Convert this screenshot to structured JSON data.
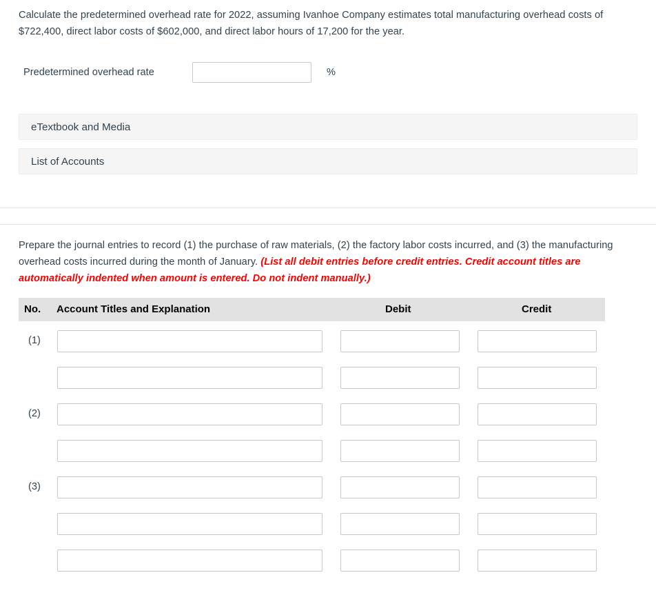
{
  "part_a": {
    "prompt": "Calculate the predetermined overhead rate for 2022, assuming Ivanhoe Company estimates total manufacturing overhead costs of $722,400, direct labor costs of $602,000, and direct labor hours of 17,200 for the year.",
    "rate_label": "Predetermined overhead rate",
    "rate_value": "",
    "rate_placeholder": "",
    "percent_symbol": "%",
    "accordions": [
      {
        "label": "eTextbook and Media"
      },
      {
        "label": "List of Accounts"
      }
    ]
  },
  "part_b": {
    "prompt_plain": "Prepare the journal entries to record (1) the purchase of raw materials, (2) the factory labor costs incurred, and (3) the manufacturing overhead costs incurred during the month of January. ",
    "prompt_note": "(List all debit entries before credit entries. Credit account titles are automatically indented when amount is entered. Do not indent manually.)",
    "table": {
      "columns": {
        "no": "No.",
        "account": "Account Titles and Explanation",
        "debit": "Debit",
        "credit": "Credit"
      },
      "rows": [
        {
          "no": "(1)",
          "account": "",
          "debit": "",
          "credit": ""
        },
        {
          "no": "",
          "account": "",
          "debit": "",
          "credit": ""
        },
        {
          "no": "(2)",
          "account": "",
          "debit": "",
          "credit": ""
        },
        {
          "no": "",
          "account": "",
          "debit": "",
          "credit": ""
        },
        {
          "no": "(3)",
          "account": "",
          "debit": "",
          "credit": ""
        },
        {
          "no": "",
          "account": "",
          "debit": "",
          "credit": ""
        },
        {
          "no": "",
          "account": "",
          "debit": "",
          "credit": ""
        }
      ]
    }
  },
  "colors": {
    "text": "#32434f",
    "note_red": "#fe0000",
    "header_gray": "#e2e2e2",
    "bar_gray": "#f5f5f5",
    "input_border": "#c8c8c8"
  }
}
